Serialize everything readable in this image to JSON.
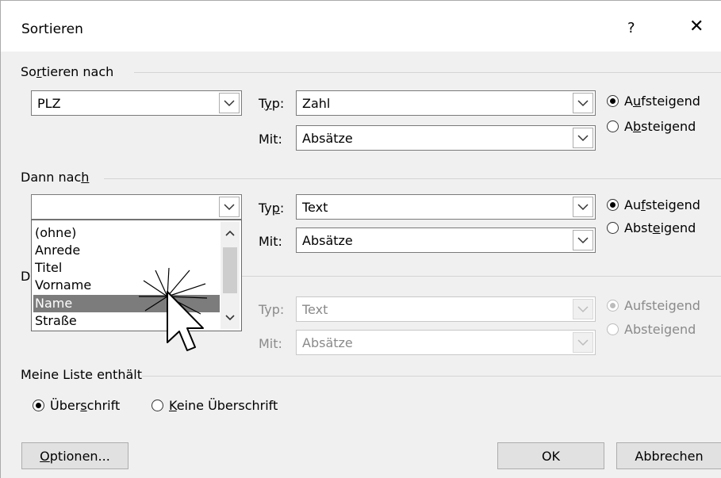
{
  "dialog": {
    "title": "Sortieren",
    "help": "?",
    "close": "✕"
  },
  "sort1": {
    "group_label_pre": "So",
    "group_label_u": "r",
    "group_label_post": "tieren nach",
    "field": "PLZ",
    "type_label_pre": "T",
    "type_label_u": "y",
    "type_label_post": "p:",
    "type_value": "Zahl",
    "mit_label": "Mit:",
    "mit_value": "Absätze",
    "asc_pre": "A",
    "asc_u": "u",
    "asc_post": "fsteigend",
    "desc_pre": "A",
    "desc_u": "b",
    "desc_post": "steigend"
  },
  "sort2": {
    "group_label_pre": "Dann nac",
    "group_label_u": "h",
    "field": "",
    "type_label_pre": "Ty",
    "type_label_u": "p",
    "type_label_post": ":",
    "type_value": "Text",
    "mit_label": "Mit:",
    "mit_value": "Absätze",
    "asc_pre": "Au",
    "asc_u": "f",
    "asc_post": "steigend",
    "desc_pre": "Abst",
    "desc_u": "e",
    "desc_post": "igend",
    "dropdown_items": [
      "(ohne)",
      "Anrede",
      "Titel",
      "Vorname",
      "Name",
      "Straße"
    ],
    "selected": "Name"
  },
  "sort3": {
    "group_label_partial": "D",
    "type_label": "Typ:",
    "type_value": "Text",
    "mit_label": "Mit:",
    "mit_value": "Absätze",
    "asc": "Aufsteigend",
    "desc": "Absteigend"
  },
  "list": {
    "group_label": "Meine Liste enthält",
    "opt1_pre": "Über",
    "opt1_u": "s",
    "opt1_post": "chrift",
    "opt2_u": "K",
    "opt2_post": "eine Überschrift"
  },
  "buttons": {
    "options_u": "O",
    "options_post": "ptionen...",
    "ok": "OK",
    "cancel": "Abbrechen"
  }
}
